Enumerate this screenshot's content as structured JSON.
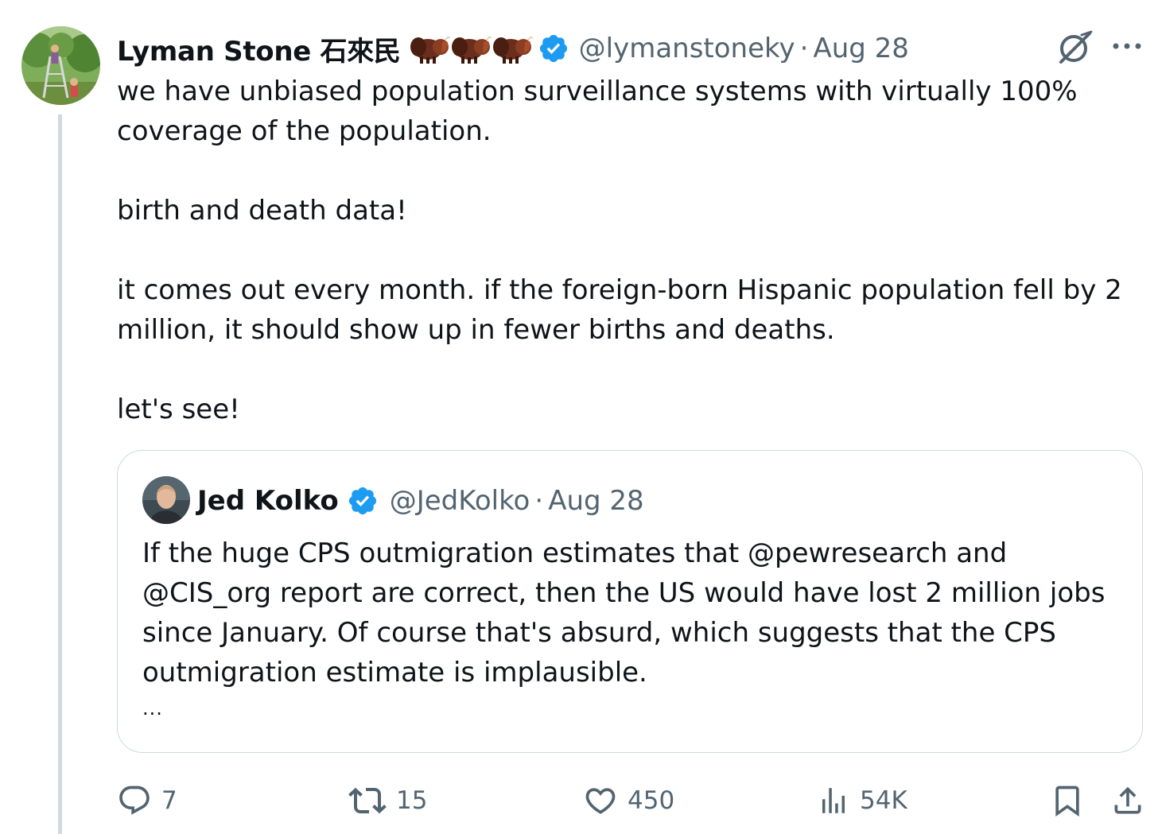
{
  "tweet": {
    "author": {
      "display_name": "Lyman Stone 石來民",
      "badge_emojis": [
        "bison",
        "bison",
        "bison"
      ],
      "verified": true,
      "handle": "@lymanstoneky",
      "separator": "·",
      "date": "Aug 28"
    },
    "paragraphs": [
      "we have unbiased population surveillance systems with virtually 100% coverage of the population.",
      "birth and death data!",
      "it comes out every month. if the foreign-born Hispanic population fell by 2 million, it should show up in fewer births and deaths.",
      "let's see!"
    ],
    "quoted": {
      "author": {
        "display_name": "Jed Kolko",
        "verified": true,
        "handle": "@JedKolko",
        "separator": "·",
        "date": "Aug 28"
      },
      "text": "If the huge CPS outmigration estimates that @pewresearch and @CIS_org report are correct, then the US would have lost 2 million jobs since January. Of course that's absurd, which suggests that the CPS outmigration estimate is implausible.",
      "truncation": "..."
    },
    "actions": {
      "replies": "7",
      "reposts": "15",
      "likes": "450",
      "views": "54K"
    }
  },
  "colors": {
    "text": "#0f1419",
    "secondary": "#536471",
    "verified": "#1d9bf0",
    "border": "#cfd9de"
  },
  "icons": {
    "reply": "reply-icon",
    "repost": "repost-icon",
    "like": "heart-icon",
    "views": "views-icon",
    "bookmark": "bookmark-icon",
    "share": "share-icon",
    "grok": "grok-icon",
    "more": "more-icon"
  }
}
